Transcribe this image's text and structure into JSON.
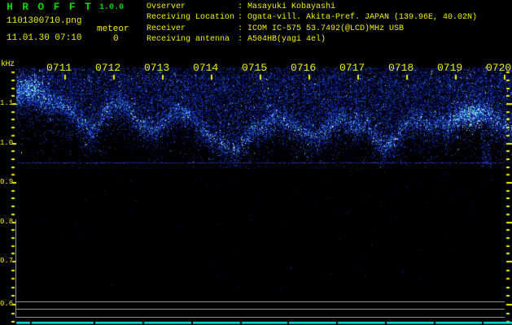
{
  "app": {
    "title": "H R O F F T",
    "version": "1.0.0",
    "filename": "1101300710.png",
    "meteor_label": "meteor",
    "meteor_count": "0",
    "datetime": "11.01.30 07:10"
  },
  "station_info": {
    "separator": ":",
    "rows": [
      {
        "label": "Ovserver",
        "value": "Masayuki Kobayashi"
      },
      {
        "label": "Receiving Location",
        "value": "Ogata-vill. Akita-Pref. JAPAN (139.96E, 40.02N)"
      },
      {
        "label": "Receiver",
        "value": "ICOM IC-575 53.7492(@LCD)MHz USB"
      },
      {
        "label": "Receiving antenna",
        "value": "A504HB(yagi 4el)"
      }
    ]
  },
  "colors": {
    "background": "#000000",
    "accent_yellow": "#f2f200",
    "title_green": "#00d800",
    "grid_gray": "#909090",
    "baseline_cyan": "#00e6e6",
    "noise_blue": "#1030c0"
  },
  "chart_data": {
    "type": "heatmap",
    "subtype": "radio-meteor-spectrogram",
    "x_axis": {
      "labels": [
        "0711",
        "0712",
        "0713",
        "0714",
        "0715",
        "0716",
        "0717",
        "0718",
        "0719",
        "0720"
      ],
      "minutes_span": 10
    },
    "y_axis": {
      "unit": "kHz",
      "labels": [
        "1.1",
        "1.0",
        "0.9",
        "0.8",
        "0.7",
        "0.6"
      ],
      "range_khz": [
        0.55,
        1.2
      ]
    },
    "noise_band_khz": [
      0.99,
      1.17
    ],
    "interference_line_khz": 0.953,
    "noise_row_khz": [
      1.171,
      1.147,
      1.122
    ],
    "meteor_count": 0,
    "ridge_trace": {
      "t_sec": [
        0,
        20,
        40,
        60,
        80,
        90,
        100,
        110,
        120,
        130,
        140,
        150,
        160,
        170,
        180,
        190,
        200,
        210,
        220,
        230,
        240,
        250,
        260,
        270,
        280,
        290,
        300,
        310,
        320,
        330,
        340,
        350,
        360,
        370,
        380,
        390,
        400,
        410,
        420,
        430,
        440,
        450,
        460,
        470,
        480,
        490,
        500,
        510,
        520,
        530,
        540,
        550,
        560,
        570,
        580,
        590,
        600,
        608
      ],
      "f_khz": [
        1.128,
        1.125,
        1.11,
        1.096,
        1.055,
        1.035,
        1.045,
        1.086,
        1.096,
        1.106,
        1.076,
        1.055,
        1.045,
        1.035,
        1.055,
        1.076,
        1.086,
        1.076,
        1.055,
        1.035,
        1.014,
        1.004,
        0.994,
        0.984,
        1.014,
        1.035,
        1.045,
        1.055,
        1.065,
        1.055,
        1.045,
        1.035,
        1.025,
        1.014,
        1.035,
        1.055,
        1.065,
        1.055,
        1.045,
        1.055,
        1.014,
        0.994,
        1.004,
        1.025,
        1.055,
        1.065,
        1.055,
        1.045,
        1.055,
        1.045,
        1.065,
        1.076,
        1.086,
        1.082,
        1.071,
        1.055,
        1.045,
        1.045
      ]
    }
  }
}
